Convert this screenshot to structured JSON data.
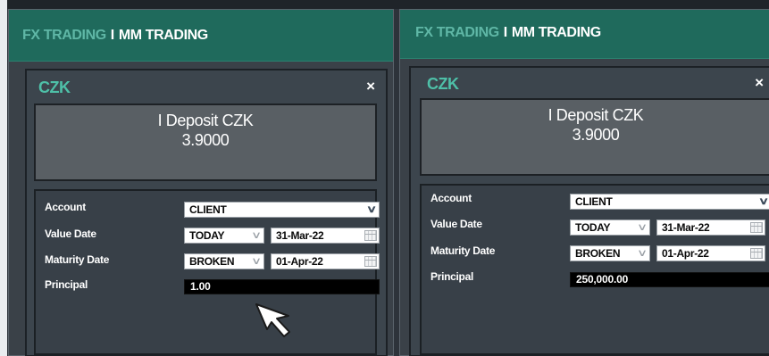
{
  "panels": [
    {
      "tabs": {
        "fx": "FX TRADING",
        "separator": "I",
        "mm": "MM TRADING"
      },
      "card": {
        "title": "CZK",
        "close_label": "×",
        "rate_name": "I Deposit CZK",
        "rate_value": "3.9000",
        "form": {
          "account_label": "Account",
          "account_value": "CLIENT",
          "value_date_label": "Value Date",
          "value_date_type": "TODAY",
          "value_date": "31-Mar-22",
          "maturity_date_label": "Maturity Date",
          "maturity_date_type": "BROKEN",
          "maturity_date": "01-Apr-22",
          "principal_label": "Principal",
          "principal_value": "1.00"
        }
      }
    },
    {
      "tabs": {
        "fx": "FX TRADING",
        "separator": "I",
        "mm": "MM TRADING"
      },
      "card": {
        "title": "CZK",
        "close_label": "×",
        "rate_name": "I Deposit CZK",
        "rate_value": "3.9000",
        "form": {
          "account_label": "Account",
          "account_value": "CLIENT",
          "value_date_label": "Value Date",
          "value_date_type": "TODAY",
          "value_date": "31-Mar-22",
          "maturity_date_label": "Maturity Date",
          "maturity_date_type": "BROKEN",
          "maturity_date": "01-Apr-22",
          "principal_label": "Principal",
          "principal_value": "250,000.00"
        }
      }
    }
  ],
  "icons": {
    "close": "close-icon",
    "dropdown": "chevron-down-icon",
    "calendar": "calendar-icon",
    "cursor": "mouse-pointer-icon"
  },
  "colors": {
    "header_bg": "#1f6a5c",
    "accent_teal": "#4ec0a8",
    "panel_bg": "#3a4148",
    "rate_box_bg": "#595f64"
  }
}
